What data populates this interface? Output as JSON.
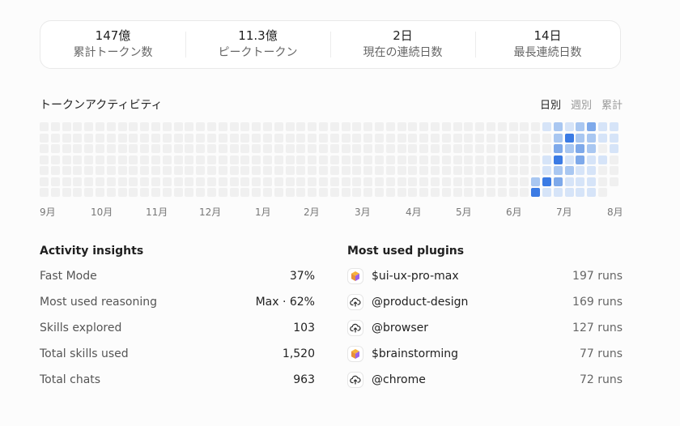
{
  "stats": [
    {
      "value": "147億",
      "label": "累計トークン数"
    },
    {
      "value": "11.3億",
      "label": "ピークトークン"
    },
    {
      "value": "2日",
      "label": "現在の連続日数"
    },
    {
      "value": "14日",
      "label": "最長連続日数"
    }
  ],
  "activity": {
    "title": "トークンアクティビティ",
    "toggles": [
      "日別",
      "週別",
      "累計"
    ],
    "active_toggle": "日別",
    "months": [
      "9月",
      "10月",
      "11月",
      "12月",
      "1月",
      "2月",
      "3月",
      "4月",
      "5月",
      "6月",
      "7月",
      "8月"
    ],
    "levels": {
      "0": "#f0f0f0",
      "1": "#d6e4f8",
      "2": "#a9c7f1",
      "3": "#7ea9ea",
      "4": "#3b7be4"
    },
    "heatmap_recent_weeks": [
      [
        0,
        0,
        0,
        0,
        0,
        2,
        4
      ],
      [
        1,
        0,
        0,
        1,
        1,
        4,
        1
      ],
      [
        2,
        2,
        3,
        4,
        2,
        3,
        1
      ],
      [
        1,
        4,
        2,
        1,
        2,
        1,
        1
      ],
      [
        2,
        2,
        3,
        3,
        1,
        1,
        1
      ],
      [
        3,
        2,
        2,
        1,
        1,
        1,
        1
      ],
      [
        1,
        1,
        0,
        1,
        0,
        0,
        0
      ],
      [
        1,
        1,
        1,
        0,
        0,
        0,
        0
      ]
    ]
  },
  "insights": {
    "title": "Activity insights",
    "rows": [
      {
        "label": "Fast Mode",
        "value": "37%"
      },
      {
        "label": "Most used reasoning",
        "value": "Max · 62%"
      },
      {
        "label": "Skills explored",
        "value": "103"
      },
      {
        "label": "Total skills used",
        "value": "1,520"
      },
      {
        "label": "Total chats",
        "value": "963"
      }
    ]
  },
  "plugins": {
    "title": "Most used plugins",
    "rows": [
      {
        "icon": "cube-icon",
        "name": "$ui-ux-pro-max",
        "runs": "197 runs"
      },
      {
        "icon": "cloud-icon",
        "name": "@product-design",
        "runs": "169 runs"
      },
      {
        "icon": "cloud-icon",
        "name": "@browser",
        "runs": "127 runs"
      },
      {
        "icon": "cube-icon",
        "name": "$brainstorming",
        "runs": "77 runs"
      },
      {
        "icon": "cloud-icon",
        "name": "@chrome",
        "runs": "72 runs"
      }
    ]
  }
}
